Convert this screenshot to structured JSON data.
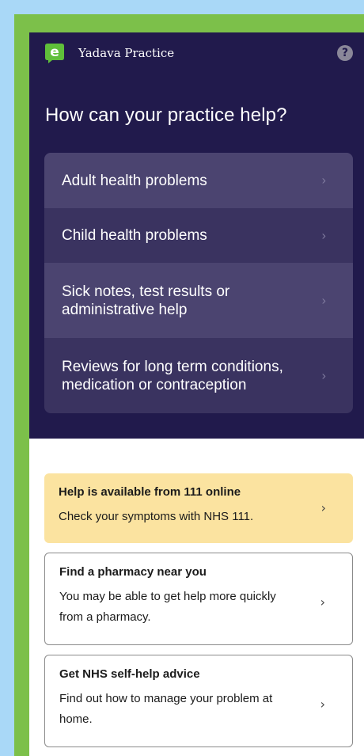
{
  "header": {
    "logo_glyph": "e",
    "practice_name": "Yadava Practice",
    "help_glyph": "?",
    "headline": "How can your practice help?"
  },
  "menu": {
    "items": [
      {
        "label": "Adult health problems",
        "chevron": "›"
      },
      {
        "label": "Child health problems",
        "chevron": "›"
      },
      {
        "label": "Sick notes, test results or administrative help",
        "chevron": "›"
      },
      {
        "label": "Reviews for long term conditions, medication or contraception",
        "chevron": "›"
      }
    ]
  },
  "cards": [
    {
      "title": "Help is available from 111 online",
      "description": "Check your symptoms with NHS 111.",
      "chevron": "›"
    },
    {
      "title": "Find a pharmacy near you",
      "description": "You may be able to get help more quickly from a pharmacy.",
      "chevron": "›"
    },
    {
      "title": "Get NHS self-help advice",
      "description": "Find out how to manage your problem at home.",
      "chevron": "›"
    }
  ],
  "colors": {
    "page_background": "#a9d8f7",
    "frame_green": "#7cc04a",
    "header_navy": "#211a4c",
    "menu_light": "#4b4470",
    "menu_dark": "#3a3360",
    "logo_green": "#5fbf3a",
    "nhs111_yellow": "#fbe3a0"
  },
  "icons": {
    "logo": "econsult-logo-icon",
    "help": "help-circle-icon",
    "chevron": "chevron-right-icon"
  }
}
